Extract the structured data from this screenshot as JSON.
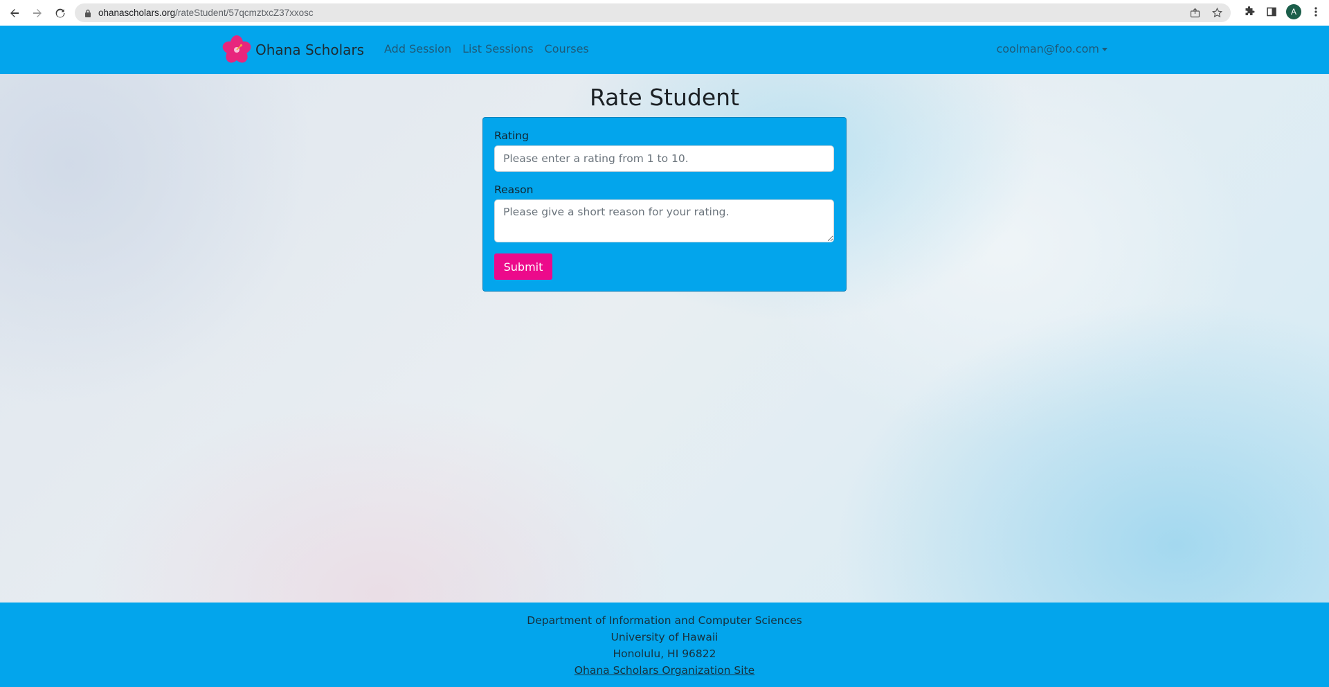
{
  "browser": {
    "url_host": "ohanascholars.org",
    "url_path": "/rateStudent/57qcmztxcZ37xxosc",
    "profile_initial": "A",
    "icons": [
      "back-arrow-icon",
      "forward-arrow-icon",
      "reload-icon",
      "lock-icon",
      "share-icon",
      "star-icon",
      "extensions-icon",
      "side-panel-icon",
      "menu-dots-icon"
    ]
  },
  "navbar": {
    "brand_name": "Ohana Scholars",
    "links": [
      "Add Session",
      "List Sessions",
      "Courses"
    ],
    "user_email": "coolman@foo.com",
    "colors": {
      "background": "#03a5ec",
      "logo": "#e8267d"
    }
  },
  "main": {
    "title": "Rate Student",
    "rating": {
      "label": "Rating",
      "value": "",
      "placeholder": "Please enter a rating from 1 to 10."
    },
    "reason": {
      "label": "Reason",
      "value": "",
      "placeholder": "Please give a short reason for your rating."
    },
    "submit_label": "Submit",
    "colors": {
      "card": "#03a5ec",
      "submit": "#ec0a8b"
    }
  },
  "footer": {
    "lines": [
      "Department of Information and Computer Sciences",
      "University of Hawaii",
      "Honolulu, HI 96822"
    ],
    "link_text": "Ohana Scholars Organization Site"
  }
}
